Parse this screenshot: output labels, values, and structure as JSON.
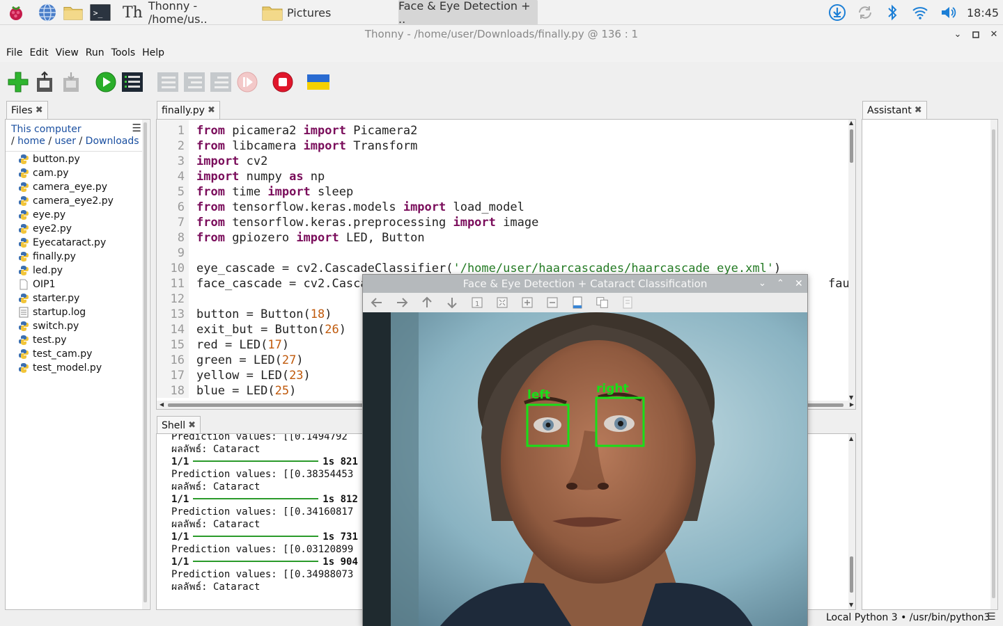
{
  "taskbar": {
    "thonny_task": "Thonny  -  /home/us..",
    "pictures_task": "Pictures",
    "active_task": "Face & Eye Detection + ..",
    "clock": "18:45"
  },
  "window": {
    "title": "Thonny  -  /home/user/Downloads/finally.py  @  136 : 1"
  },
  "menu": [
    "File",
    "Edit",
    "View",
    "Run",
    "Tools",
    "Help"
  ],
  "files": {
    "tab_label": "Files",
    "this_computer": "This computer",
    "crumb_sep": "/",
    "crumbs": [
      "home",
      "user",
      "Downloads"
    ],
    "items": [
      {
        "name": "button.py",
        "type": "py"
      },
      {
        "name": "cam.py",
        "type": "py"
      },
      {
        "name": "camera_eye.py",
        "type": "py"
      },
      {
        "name": "camera_eye2.py",
        "type": "py"
      },
      {
        "name": "eye.py",
        "type": "py"
      },
      {
        "name": "eye2.py",
        "type": "py"
      },
      {
        "name": "Eyecataract.py",
        "type": "py"
      },
      {
        "name": "finally.py",
        "type": "py"
      },
      {
        "name": "led.py",
        "type": "py"
      },
      {
        "name": "OIP1",
        "type": "file"
      },
      {
        "name": "starter.py",
        "type": "py"
      },
      {
        "name": "startup.log",
        "type": "log"
      },
      {
        "name": "switch.py",
        "type": "py"
      },
      {
        "name": "test.py",
        "type": "py"
      },
      {
        "name": "test_cam.py",
        "type": "py"
      },
      {
        "name": "test_model.py",
        "type": "py"
      }
    ]
  },
  "editor": {
    "tab_label": "finally.py",
    "lines": [
      [
        {
          "t": "from",
          "c": "kw"
        },
        {
          "t": " picamera2 "
        },
        {
          "t": "import",
          "c": "kw"
        },
        {
          "t": " Picamera2"
        }
      ],
      [
        {
          "t": "from",
          "c": "kw"
        },
        {
          "t": " libcamera "
        },
        {
          "t": "import",
          "c": "kw"
        },
        {
          "t": " Transform"
        }
      ],
      [
        {
          "t": "import",
          "c": "kw"
        },
        {
          "t": " cv2"
        }
      ],
      [
        {
          "t": "import",
          "c": "kw"
        },
        {
          "t": " numpy "
        },
        {
          "t": "as",
          "c": "kw"
        },
        {
          "t": " np"
        }
      ],
      [
        {
          "t": "from",
          "c": "kw"
        },
        {
          "t": " time "
        },
        {
          "t": "import",
          "c": "kw"
        },
        {
          "t": " sleep"
        }
      ],
      [
        {
          "t": "from",
          "c": "kw"
        },
        {
          "t": " tensorflow.keras.models "
        },
        {
          "t": "import",
          "c": "kw"
        },
        {
          "t": " load_model"
        }
      ],
      [
        {
          "t": "from",
          "c": "kw"
        },
        {
          "t": " tensorflow.keras.preprocessing "
        },
        {
          "t": "import",
          "c": "kw"
        },
        {
          "t": " image"
        }
      ],
      [
        {
          "t": "from",
          "c": "kw"
        },
        {
          "t": " gpiozero "
        },
        {
          "t": "import",
          "c": "kw"
        },
        {
          "t": " LED, Button"
        }
      ],
      [],
      [
        {
          "t": "eye_cascade = cv2.CascadeClassifier("
        },
        {
          "t": "'/home/user/haarcascades/haarcascade_eye.xml'",
          "c": "str"
        },
        {
          "t": ")"
        }
      ],
      [
        {
          "t": "face_cascade = cv2.Casca"
        }
      ],
      [],
      [
        {
          "t": "button = Button("
        },
        {
          "t": "18",
          "c": "num"
        },
        {
          "t": ")"
        }
      ],
      [
        {
          "t": "exit_but = Button("
        },
        {
          "t": "26",
          "c": "num"
        },
        {
          "t": ")"
        }
      ],
      [
        {
          "t": "red = LED("
        },
        {
          "t": "17",
          "c": "num"
        },
        {
          "t": ")"
        }
      ],
      [
        {
          "t": "green = LED("
        },
        {
          "t": "27",
          "c": "num"
        },
        {
          "t": ")"
        }
      ],
      [
        {
          "t": "yellow = LED("
        },
        {
          "t": "23",
          "c": "num"
        },
        {
          "t": ")"
        }
      ],
      [
        {
          "t": "blue = LED("
        },
        {
          "t": "25",
          "c": "num"
        },
        {
          "t": ")"
        }
      ]
    ],
    "line11_tail": "fault"
  },
  "shell": {
    "tab_label": "Shell",
    "lines": [
      {
        "kind": "text",
        "text": "Prediction values: [[0.1494792"
      },
      {
        "kind": "text",
        "text": "ผลลัพธ์: Cataract"
      },
      {
        "kind": "prog",
        "step": "1/1",
        "time": "1s 821"
      },
      {
        "kind": "text",
        "text": "Prediction values: [[0.38354453"
      },
      {
        "kind": "text",
        "text": "ผลลัพธ์: Cataract"
      },
      {
        "kind": "prog",
        "step": "1/1",
        "time": "1s 812"
      },
      {
        "kind": "text",
        "text": "Prediction values: [[0.34160817"
      },
      {
        "kind": "text",
        "text": "ผลลัพธ์: Cataract"
      },
      {
        "kind": "prog",
        "step": "1/1",
        "time": "1s 731"
      },
      {
        "kind": "text",
        "text": "Prediction values: [[0.03120899"
      },
      {
        "kind": "prog",
        "step": "1/1",
        "time": "1s 904"
      },
      {
        "kind": "text",
        "text": "Prediction values: [[0.34988073"
      },
      {
        "kind": "text",
        "text": "ผลลัพธ์: Cataract"
      }
    ]
  },
  "assistant": {
    "tab_label": "Assistant"
  },
  "status": {
    "interpreter": "Local Python 3  •  /usr/bin/python3"
  },
  "cv_window": {
    "title": "Face & Eye Detection + Cataract Classification",
    "left_label": "left",
    "right_label": "right",
    "box_color": "#18e018"
  }
}
